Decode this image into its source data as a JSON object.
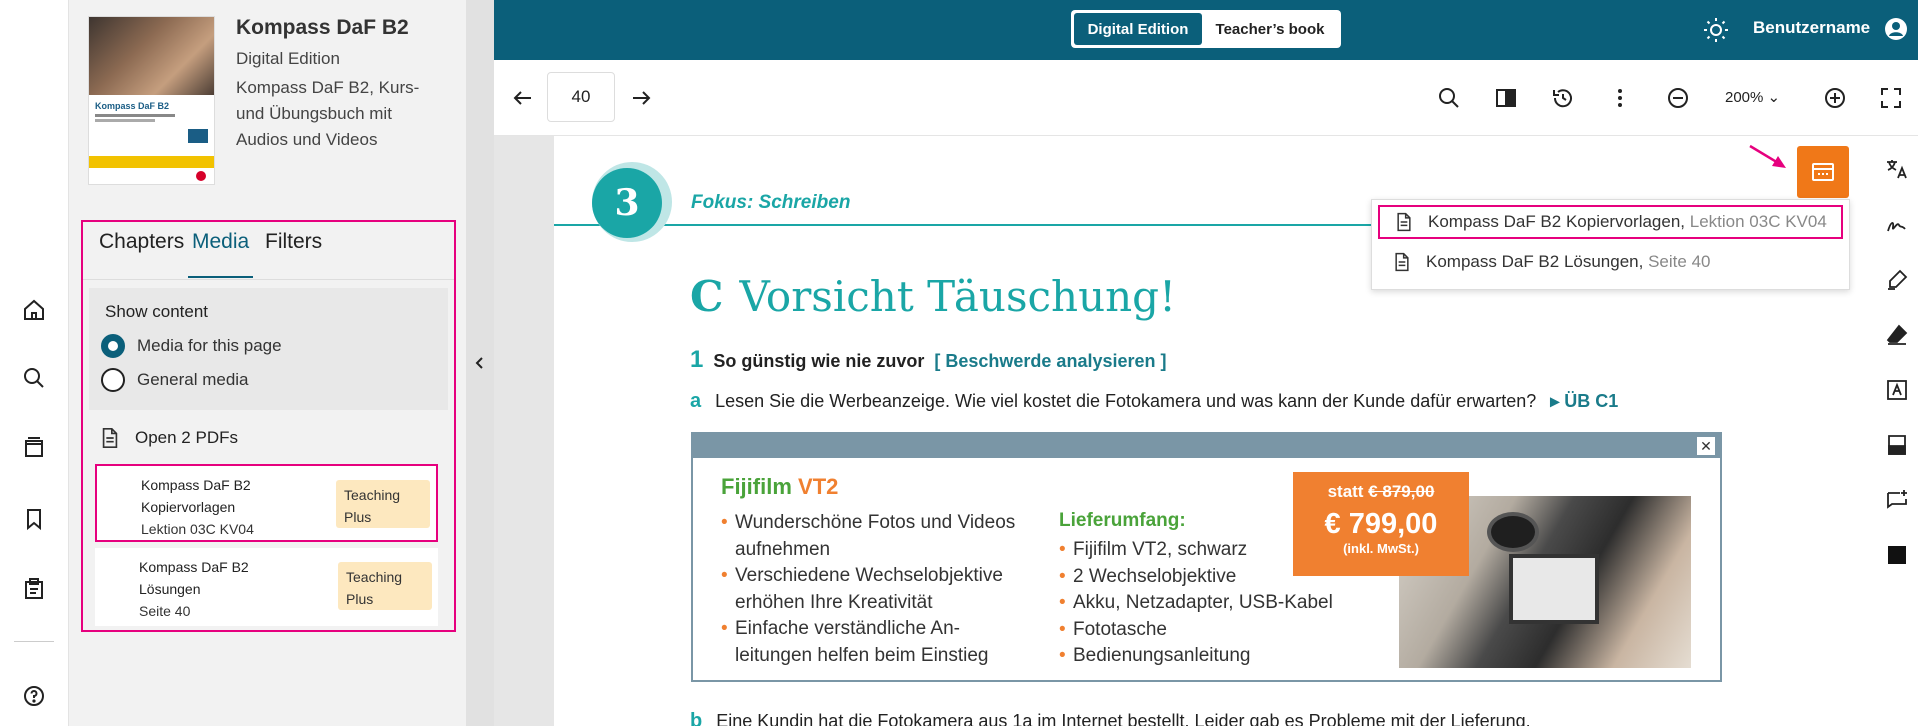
{
  "book": {
    "title": "Kompass DaF B2",
    "edition": "Digital Edition",
    "description": "Kompass DaF B2, Kurs- und Übungsbuch mit Audios und Videos",
    "cover_title": "Kompass DaF B2"
  },
  "tabs": [
    {
      "label": "Chapters",
      "active": false
    },
    {
      "label": "Media",
      "active": true
    },
    {
      "label": "Filters",
      "active": false
    }
  ],
  "show_content": {
    "heading": "Show content",
    "options": [
      {
        "label": "Media for this page",
        "selected": true
      },
      {
        "label": "General media",
        "selected": false
      }
    ]
  },
  "pdfs": {
    "header": "Open 2 PDFs",
    "items": [
      {
        "name": "Kompass DaF B2 Kopiervorlagen",
        "location": "Lektion 03C KV04",
        "badge": "Teaching Plus"
      },
      {
        "name": "Kompass DaF B2 Lösungen",
        "location": "Seite 40",
        "badge": "Teaching Plus"
      }
    ]
  },
  "topbar": {
    "modes": [
      "Digital Edition",
      "Teacher’s book"
    ],
    "active_mode": "Digital Edition",
    "username": "Benutzername"
  },
  "toolbar": {
    "page": "40",
    "zoom": "200%"
  },
  "page_content": {
    "chapter_number": "3",
    "focus": "Fokus: Schreiben",
    "section_letter": "C",
    "title": "Vorsicht Täuschung!",
    "task1_num": "1",
    "task1_text": "So günstig wie nie zuvor",
    "task1_tag": "[ Beschwerde analysieren ]",
    "taska_num": "a",
    "taska_text": "Lesen Sie die Werbeanzeige. Wie viel kostet die Fotokamera und was kann der Kunde dafür erwarten?",
    "taska_ref": "▸ ÜB C1",
    "taskb_num": "b",
    "taskb_text": "Eine Kundin hat die Fotokamera aus 1a im Internet bestellt. Leider gab es Probleme mit der Lieferung."
  },
  "ad": {
    "brand": "Fijifilm",
    "model": "VT2",
    "features": [
      "Wunderschöne Fotos und Videos aufnehmen",
      "Verschiedene Wechselobjektive erhöhen Ihre Kreativität",
      "Einfache verständliche An-leitungen helfen beim Einstieg"
    ],
    "scope_label": "Lieferumfang:",
    "scope_items": [
      "Fijifilm VT2, schwarz",
      "2 Wechselobjektive",
      "Akku, Netzadapter, USB-Kabel",
      "Fototasche",
      "Bedienungsanleitung"
    ],
    "price_old_prefix": "statt",
    "price_old": "€ 879,00",
    "price_new": "€ 799,00",
    "price_vat": "(inkl. MwSt.)",
    "close": "✕"
  },
  "popover": {
    "items": [
      {
        "name": "Kompass DaF B2 Kopiervorlagen,",
        "location": "Lektion 03C KV04"
      },
      {
        "name": "Kompass DaF B2 Lösungen,",
        "location": "Seite 40"
      }
    ]
  },
  "colors": {
    "brand_teal": "#0b5f7a",
    "accent_cyan": "#1aa6a6",
    "highlight_pink": "#e6007e",
    "media_orange": "#f07818"
  }
}
